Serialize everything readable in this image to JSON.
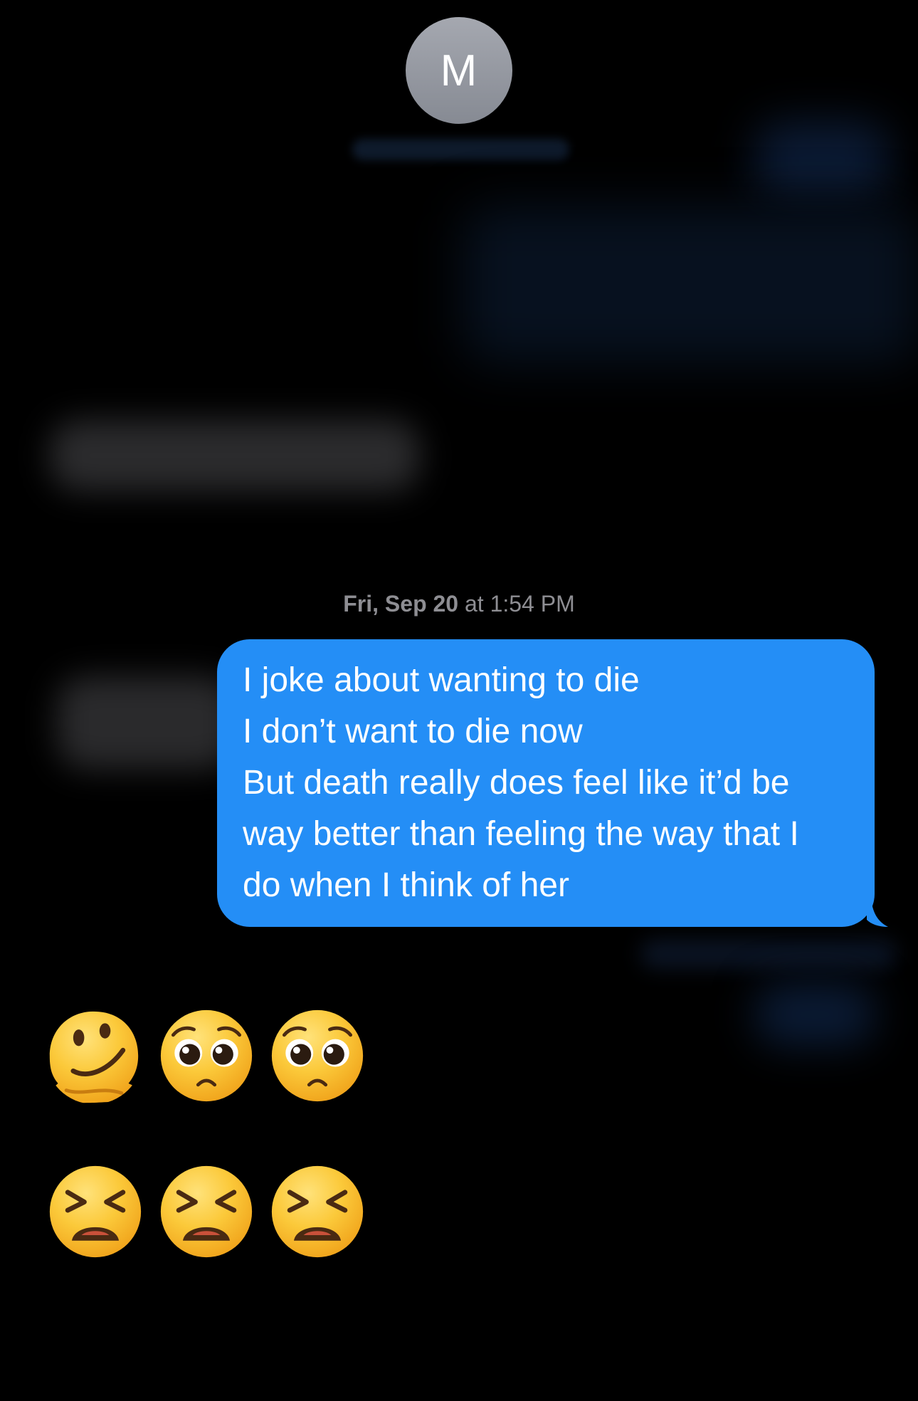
{
  "header": {
    "avatar_initial": "M"
  },
  "thread": {
    "timestamp_date": "Fri, Sep 20",
    "timestamp_time": " at 1:54 PM",
    "sent_message_lines": [
      "I joke about wanting to die",
      "I don’t want to die now",
      "But death really does feel like it’d be",
      "way better than feeling the way that I",
      "do when I think of her"
    ],
    "bubble_color": "#248ef6",
    "emoji_rows": [
      [
        "melting-face-emoji",
        "pleading-face-emoji",
        "pleading-face-emoji"
      ],
      [
        "tired-face-emoji",
        "tired-face-emoji",
        "tired-face-emoji"
      ]
    ]
  }
}
